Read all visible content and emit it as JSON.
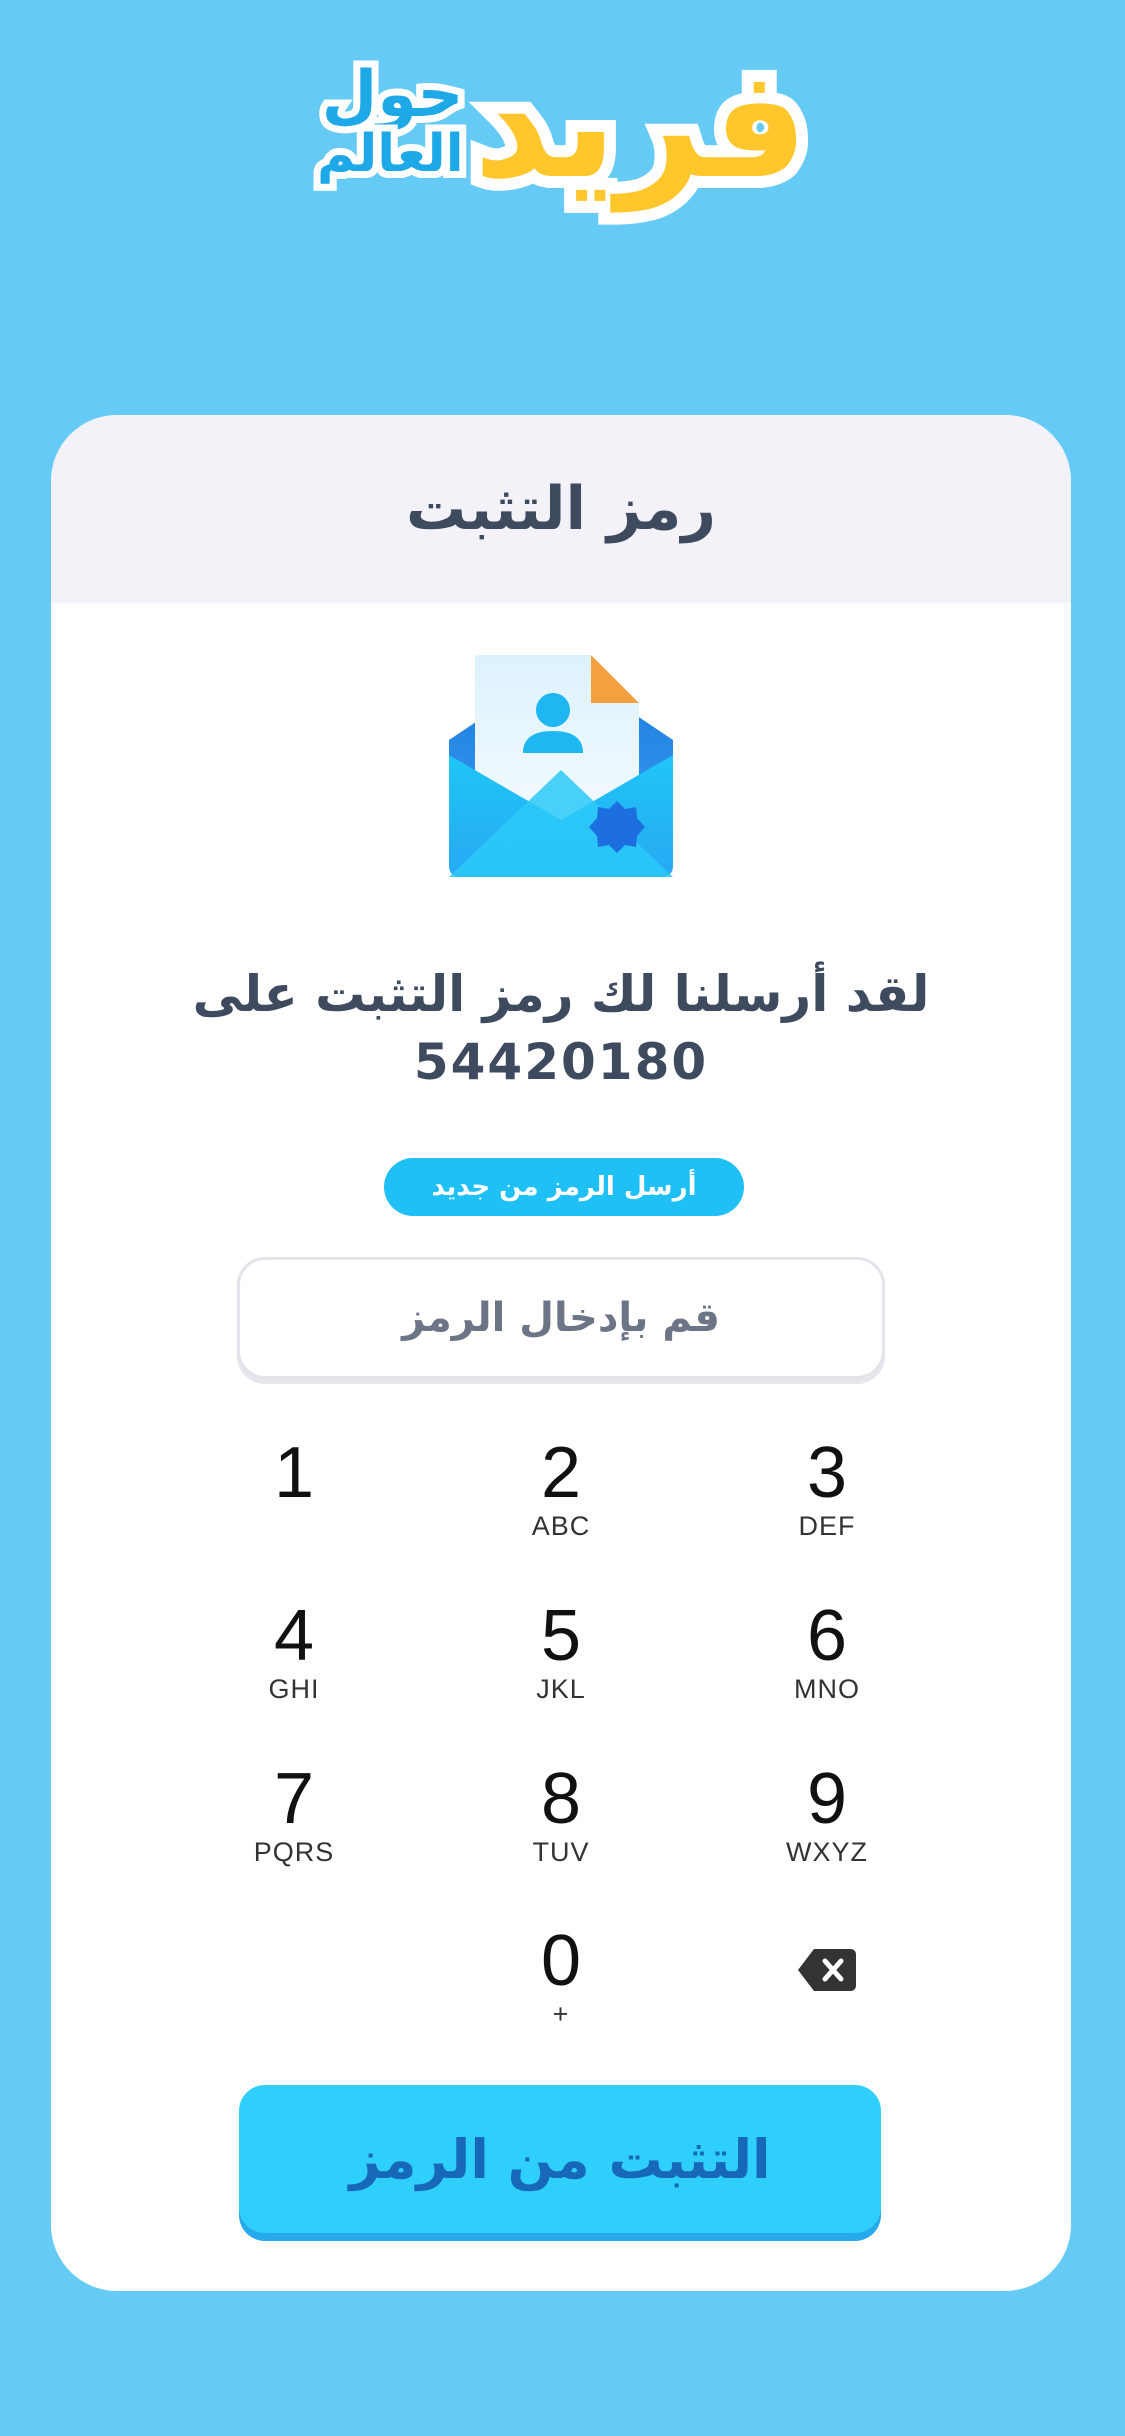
{
  "logo": {
    "main": "فريد",
    "sub_line1": "حول",
    "sub_line2": "العالم"
  },
  "card": {
    "title": "رمز التثبت",
    "message_line1": "لقد أرسلنا لك رمز التثبت على",
    "phone_number": "54420180",
    "resend_label": "أرسل الرمز من جديد",
    "code_placeholder": "قم بإدخال الرمز",
    "verify_label": "التثبت من الرمز"
  },
  "keypad": {
    "keys": [
      {
        "num": "1",
        "letters": ""
      },
      {
        "num": "2",
        "letters": "ABC"
      },
      {
        "num": "3",
        "letters": "DEF"
      },
      {
        "num": "4",
        "letters": "GHI"
      },
      {
        "num": "5",
        "letters": "JKL"
      },
      {
        "num": "6",
        "letters": "MNO"
      },
      {
        "num": "7",
        "letters": "PQRS"
      },
      {
        "num": "8",
        "letters": "TUV"
      },
      {
        "num": "9",
        "letters": "WXYZ"
      },
      {
        "num": "0",
        "letters": "+"
      }
    ],
    "delete_icon": "backspace-icon"
  },
  "colors": {
    "background": "#65CBF5",
    "accent": "#2FCFFB",
    "logo_yellow": "#FFC72C",
    "logo_blue": "#1DA8E8",
    "title_text": "#3E4A5E",
    "verify_text": "#1768B8"
  }
}
